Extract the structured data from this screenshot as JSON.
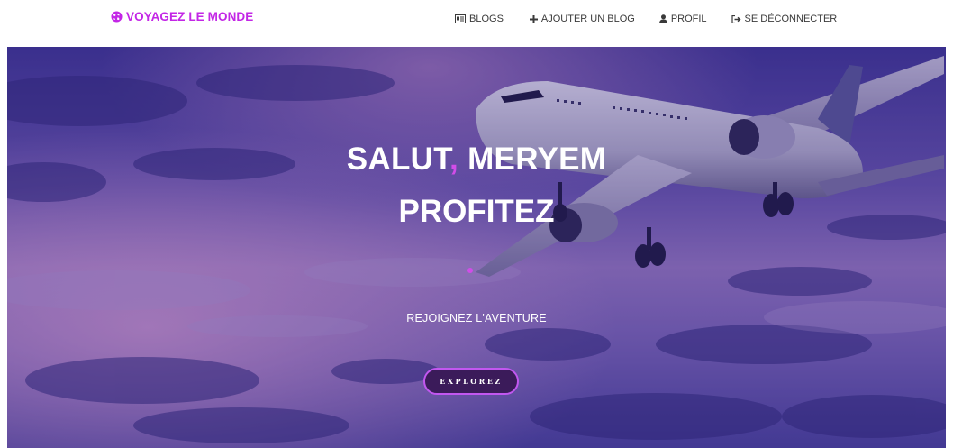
{
  "brand": {
    "label": "VOYAGEZ LE MONDE",
    "icon": "globe-icon",
    "color": "#c326e6"
  },
  "nav": {
    "items": [
      {
        "label": "BLOGS",
        "icon": "id-card-icon"
      },
      {
        "label": "AJOUTER UN BLOG",
        "icon": "plus-icon"
      },
      {
        "label": "PROFIL",
        "icon": "user-icon"
      },
      {
        "label": "SE DÉCONNECTER",
        "icon": "sign-out-icon"
      }
    ]
  },
  "hero": {
    "greeting_prefix": "SALUT",
    "comma": ",",
    "greeting_name": " MERYEM",
    "line2": "PROFITEZ",
    "tagline": "REJOIGNEZ L'AVENTURE",
    "button_label": "EXPLOREZ",
    "accent_color": "#d14de8",
    "image": "airplane-in-purple-sky"
  }
}
